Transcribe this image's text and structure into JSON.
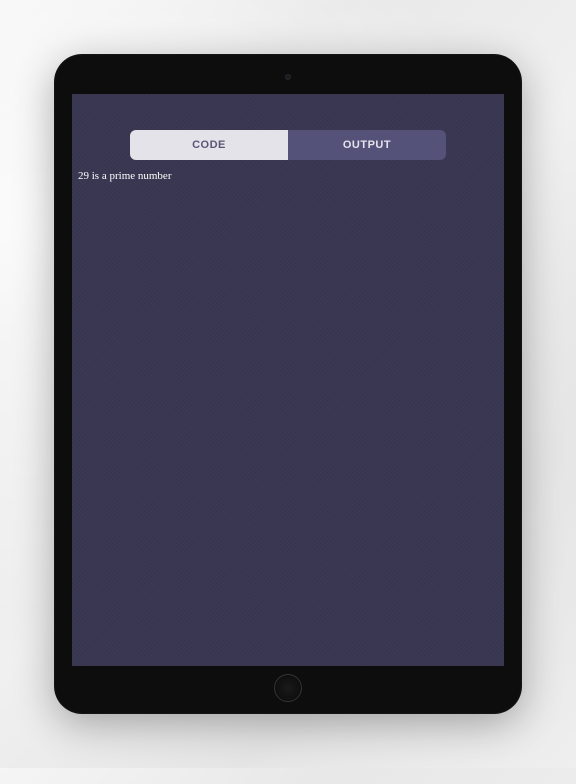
{
  "tabs": {
    "code_label": "CODE",
    "output_label": "OUTPUT",
    "active": "output"
  },
  "output": {
    "text": "29 is a prime number"
  }
}
